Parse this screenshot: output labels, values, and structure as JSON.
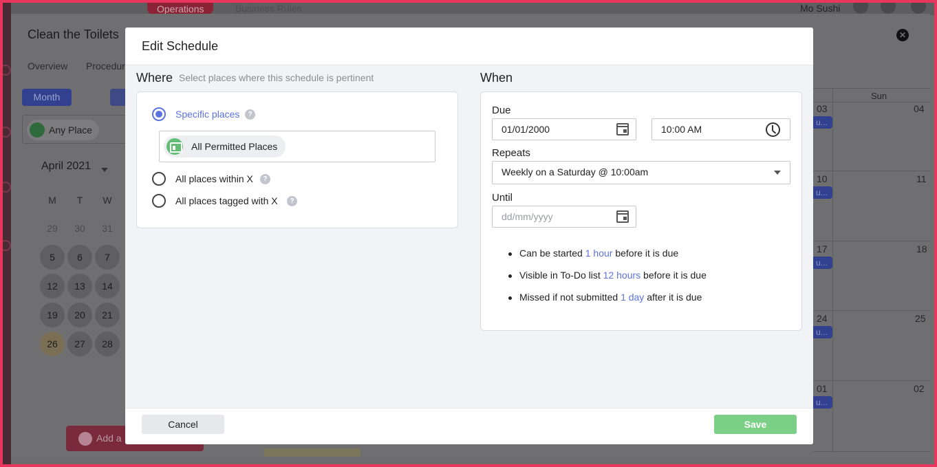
{
  "background": {
    "top_tabs": [
      "Operations",
      "Business Rules"
    ],
    "user_name": "Mo Sushi",
    "task_title": "Clean the Toilets",
    "tabs": [
      "Overview",
      "Procedur"
    ],
    "view_button": "Month",
    "place_filter": "Any Place",
    "month_label": "April 2021",
    "weekday_headers": [
      "M",
      "T",
      "W"
    ],
    "calendar_days": [
      [
        "29",
        "30",
        "31"
      ],
      [
        "5",
        "6",
        "7"
      ],
      [
        "12",
        "13",
        "14"
      ],
      [
        "19",
        "20",
        "21"
      ],
      [
        "26",
        "27",
        "28"
      ]
    ],
    "add_button": "Add a",
    "week_column_header": "Sun",
    "week_col_sat_dates": [
      "03",
      "10",
      "17",
      "24",
      "01"
    ],
    "week_col_sun_dates": [
      "04",
      "11",
      "18",
      "25",
      "02"
    ],
    "event_stub": "u...",
    "close_icon": "close-icon"
  },
  "modal": {
    "title": "Edit Schedule",
    "where": {
      "title": "Where",
      "subtitle": "Select places where this schedule is pertinent",
      "options": [
        {
          "label": "Specific places",
          "selected": true
        },
        {
          "label": "All places within X",
          "selected": false
        },
        {
          "label": "All places tagged with X",
          "selected": false
        }
      ],
      "selected_place": "All Permitted Places",
      "help_symbol": "?"
    },
    "when": {
      "title": "When",
      "due_label": "Due",
      "due_date": "01/01/2000",
      "due_time": "10:00 AM",
      "repeats_label": "Repeats",
      "repeats_value": "Weekly on a Saturday @ 10:00am",
      "until_label": "Until",
      "until_placeholder": "dd/mm/yyyy",
      "rules": [
        {
          "before": "Can be started",
          "highlight": "1 hour",
          "after": "before it is due"
        },
        {
          "before": "Visible in To-Do list",
          "highlight": "12 hours",
          "after": "before it is due"
        },
        {
          "before": "Missed if not submitted",
          "highlight": "1 day",
          "after": "after it is due"
        }
      ]
    },
    "footer": {
      "cancel_label": "Cancel",
      "save_label": "Save"
    }
  },
  "colors": {
    "accent": "#5b72e0",
    "save_green": "#7bcf86",
    "frame_border": "#e8365f",
    "place_icon_green": "#61bd73"
  }
}
